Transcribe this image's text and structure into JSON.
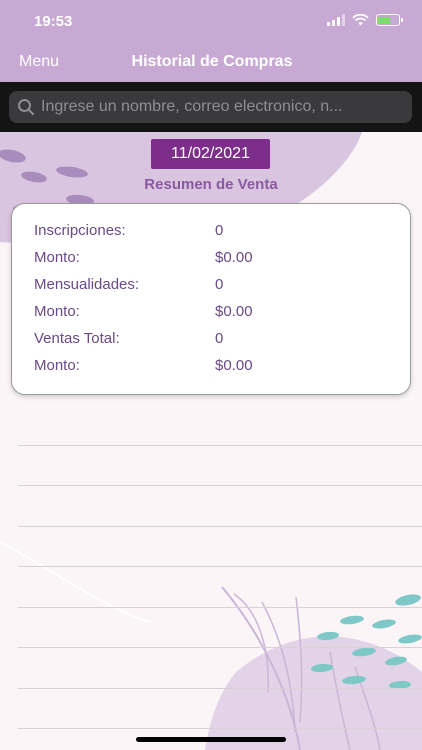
{
  "status_bar": {
    "time": "19:53"
  },
  "nav": {
    "menu_label": "Menu",
    "title": "Historial de Compras"
  },
  "search": {
    "placeholder": "Ingrese un nombre, correo electronico, n..."
  },
  "summary": {
    "date": "11/02/2021",
    "title": "Resumen de Venta",
    "rows": [
      {
        "label": "Inscripciones:",
        "value": "0"
      },
      {
        "label": "Monto:",
        "value": "$0.00"
      },
      {
        "label": "Mensualidades:",
        "value": "0"
      },
      {
        "label": "Monto:",
        "value": "$0.00"
      },
      {
        "label": "Ventas Total:",
        "value": "0"
      },
      {
        "label": "Monto:",
        "value": "$0.00"
      }
    ]
  },
  "colors": {
    "bar": "#c8a9d4",
    "accent": "#7d2e8a",
    "text": "#6a4a86",
    "background": "#fbf5f8"
  }
}
